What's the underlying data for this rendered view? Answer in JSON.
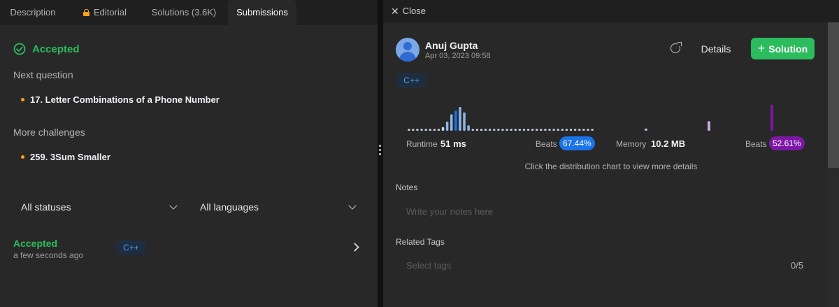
{
  "left_panel": {
    "tabs": [
      {
        "label": "Description"
      },
      {
        "label": "Editorial"
      },
      {
        "label": "Solutions (3.6K)"
      },
      {
        "label": "Submissions"
      }
    ],
    "status_title": "Accepted",
    "next_question_label": "Next question",
    "next_question": "17. Letter Combinations of a Phone Number",
    "more_challenges_label": "More challenges",
    "more_challenge": "259. 3Sum Smaller",
    "filters": {
      "status": "All statuses",
      "language": "All languages"
    },
    "submission": {
      "status": "Accepted",
      "time": "a few seconds ago",
      "language": "C++"
    }
  },
  "right_panel": {
    "close_label": "Close",
    "user": {
      "name": "Anuj Gupta",
      "date": "Apr 03, 2023 09:58"
    },
    "details_label": "Details",
    "solution_label": "Solution",
    "language": "C++",
    "runtime": {
      "label": "Runtime",
      "value": "51 ms",
      "beats_label": "Beats",
      "beats": "67.44%",
      "color": "#1a73e8"
    },
    "memory": {
      "label": "Memory",
      "value": "10.2 MB",
      "beats_label": "Beats",
      "beats": "52.61%",
      "color": "#7d17a5"
    },
    "hint": "Click the distribution chart to view more details",
    "notes_label": "Notes",
    "notes_placeholder": "Write your notes here",
    "tags_label": "Related Tags",
    "tags_placeholder": "Select tags",
    "tags_count": "0/5"
  },
  "colors": {
    "accent_green": "#2cbb5d",
    "accent_orange": "#ffa116",
    "runtime_blue": "#1a73e8",
    "memory_purple": "#7d17a5"
  },
  "chart_data": [
    {
      "type": "bar",
      "series": [
        {
          "values": [
            1,
            1,
            1,
            1,
            1,
            1,
            1,
            1,
            2,
            5,
            9,
            11,
            13,
            10,
            3,
            1,
            1,
            1,
            1,
            1,
            1,
            1,
            1,
            1,
            1,
            1,
            1,
            1,
            1,
            1,
            1,
            1,
            1,
            1,
            1,
            1,
            1,
            1,
            1,
            1,
            1,
            1,
            1,
            1
          ]
        }
      ],
      "highlight_index": 11
    },
    {
      "type": "bar",
      "series": [
        {
          "values": [
            0.3,
            0,
            0,
            0,
            0,
            0,
            0,
            0,
            0,
            0,
            0,
            0,
            0,
            0,
            0,
            1.3,
            0,
            0,
            0,
            0,
            0,
            0,
            0,
            0,
            0,
            0,
            0,
            0,
            0,
            0,
            3.5
          ]
        }
      ],
      "highlight_index": 30
    }
  ]
}
